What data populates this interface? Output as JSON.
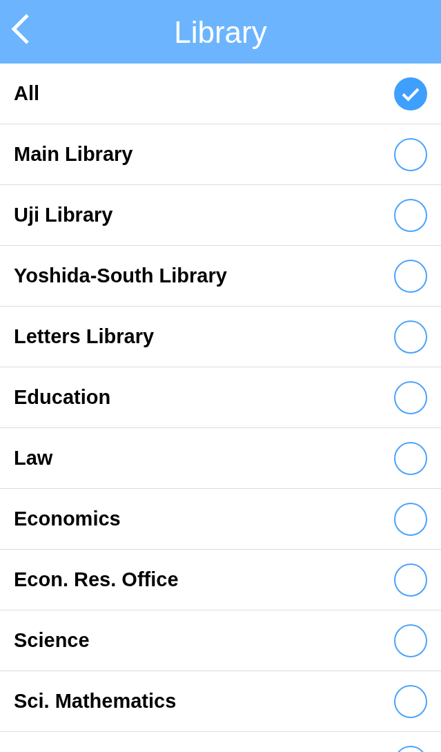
{
  "header": {
    "title": "Library"
  },
  "options": [
    {
      "label": "All",
      "selected": true
    },
    {
      "label": "Main Library",
      "selected": false
    },
    {
      "label": "Uji Library",
      "selected": false
    },
    {
      "label": "Yoshida-South Library",
      "selected": false
    },
    {
      "label": "Letters Library",
      "selected": false
    },
    {
      "label": "Education",
      "selected": false
    },
    {
      "label": "Law",
      "selected": false
    },
    {
      "label": "Economics",
      "selected": false
    },
    {
      "label": "Econ. Res. Office",
      "selected": false
    },
    {
      "label": "Science",
      "selected": false
    },
    {
      "label": "Sci. Mathematics",
      "selected": false
    },
    {
      "selected": false
    }
  ]
}
